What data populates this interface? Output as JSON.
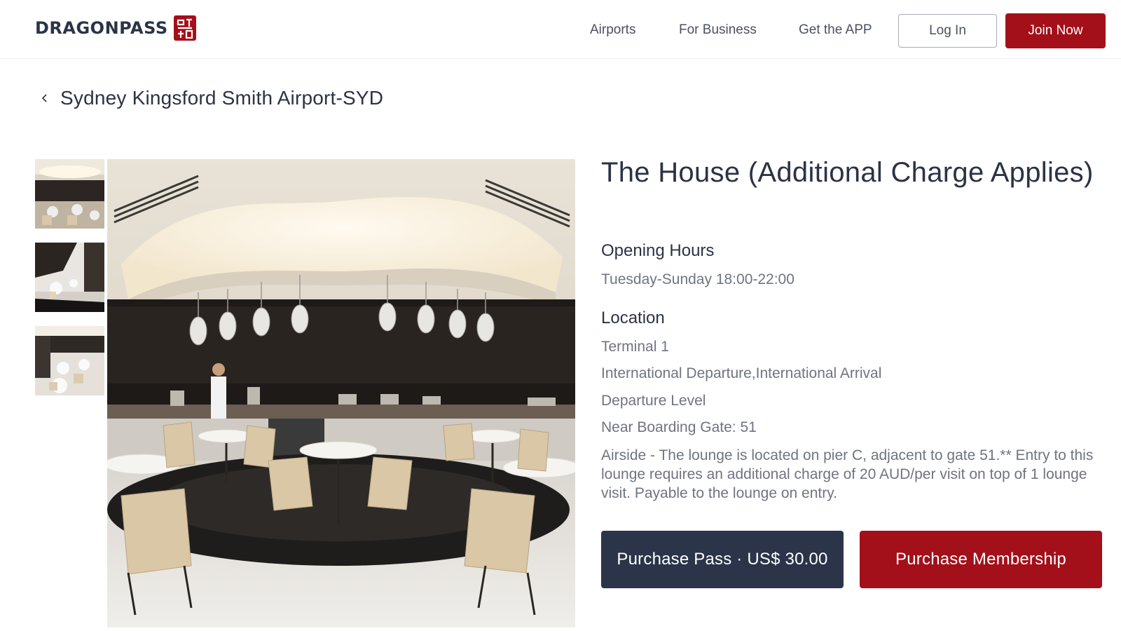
{
  "brand": {
    "name": "DRAGONPASS",
    "accent": "#a3101a",
    "navy": "#2b3449"
  },
  "nav": {
    "airports": "Airports",
    "business": "For Business",
    "app": "Get the APP",
    "login": "Log In",
    "join": "Join Now"
  },
  "breadcrumb": {
    "icon": "chevron-left-icon",
    "label": "Sydney Kingsford Smith Airport-SYD"
  },
  "lounge": {
    "name": "The House (Additional Charge Applies)",
    "opening_hours_label": "Opening Hours",
    "opening_hours": "Tuesday-Sunday 18:00-22:00",
    "location_label": "Location",
    "terminal": "Terminal 1",
    "departure_type": "International Departure,International Arrival",
    "level": "Departure Level",
    "gate": "Near Boarding Gate: 51",
    "description": "Airside - The lounge is located on pier C, adjacent to gate 51.** Entry to this lounge requires an additional charge of 20 AUD/per visit on top of 1 lounge visit. Payable to the lounge on entry."
  },
  "actions": {
    "purchase_pass": "Purchase Pass · US$ 30.00",
    "purchase_membership": "Purchase Membership"
  },
  "gallery": {
    "thumbnail_count": 3,
    "selected_index": 0
  }
}
